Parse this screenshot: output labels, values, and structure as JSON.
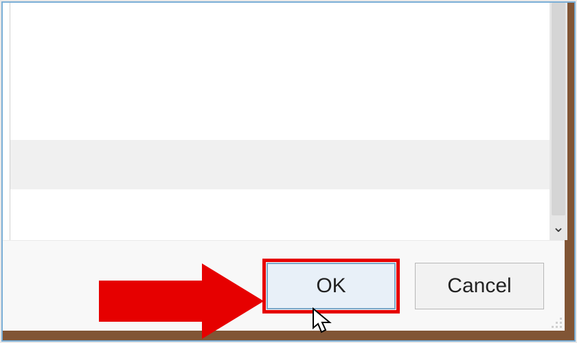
{
  "dialog": {
    "ok_label": "OK",
    "cancel_label": "Cancel"
  },
  "icons": {
    "scroll_down": "⌄"
  },
  "annotation": {
    "arrow_color": "#e60000",
    "highlight_color": "#e60000"
  }
}
